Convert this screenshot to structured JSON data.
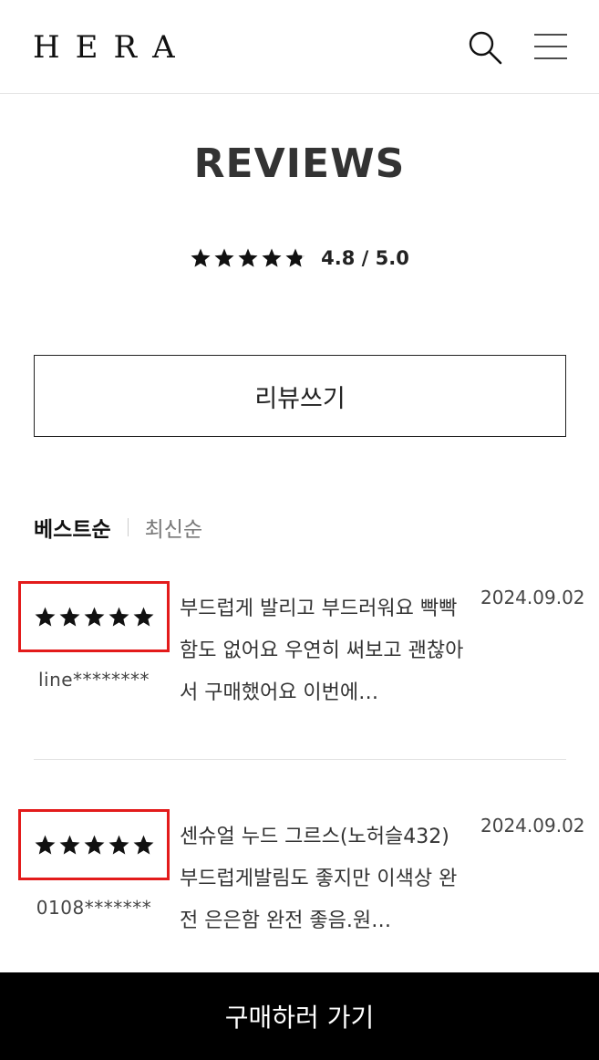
{
  "header": {
    "logo_text": "HERA",
    "search_icon": "search-icon",
    "menu_icon": "hamburger-menu-icon"
  },
  "reviews": {
    "title": "REVIEWS",
    "average_rating": 4.8,
    "score_text": "4.8 / 5.0",
    "write_button_label": "리뷰쓰기",
    "sort_tabs": [
      {
        "label": "베스트순",
        "active": true
      },
      {
        "label": "최신순",
        "active": false
      }
    ],
    "items": [
      {
        "stars": 5,
        "author": "line********",
        "body": "부드럽게 발리고 부드러워요 빡빡함도 없어요 우연히 써보고 괜찮아서 구매했어요 이번에…",
        "date": "2024.09.02"
      },
      {
        "stars": 5,
        "author": "0108*******",
        "body": "센슈얼 누드 그르스(노허슬432) 부드럽게발림도 좋지만 이색상 완전 은은함 완전 좋음.원…",
        "date": "2024.09.02"
      }
    ]
  },
  "cta": {
    "label": "구매하러 가기"
  },
  "colors": {
    "star": "#111111",
    "highlight_box": "#e31b1b",
    "cta_background": "#000000",
    "cta_text": "#ffffff"
  }
}
